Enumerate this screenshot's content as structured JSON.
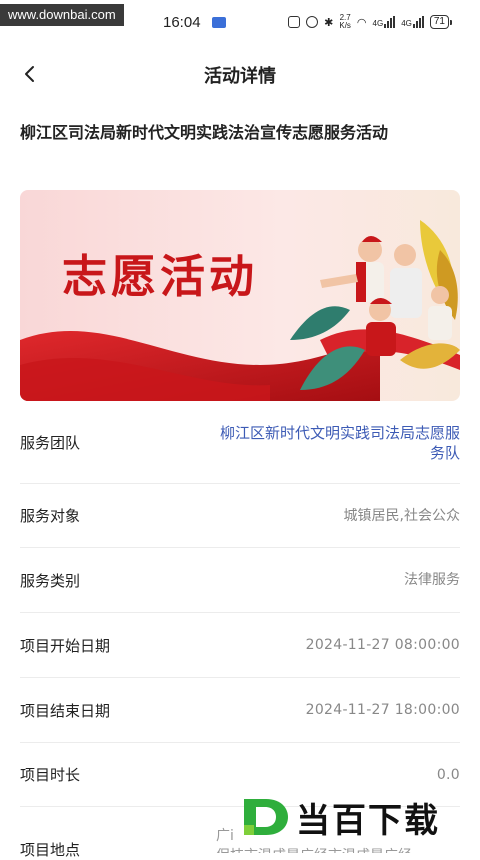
{
  "watermark_top": "www.downbai.com",
  "status": {
    "time": "16:04",
    "net_speed_top": "2.7",
    "net_speed_bottom": "K/s",
    "battery": "71",
    "net1": "4G",
    "net2": "4G"
  },
  "header": {
    "title": "活动详情"
  },
  "activity": {
    "title": "柳江区司法局新时代文明实践法治宣传志愿服务活动",
    "banner_text": "志愿活动"
  },
  "details": [
    {
      "label": "服务团队",
      "value": "柳江区新时代文明实践司法局志愿服务队"
    },
    {
      "label": "服务对象",
      "value": "城镇居民,社会公众"
    },
    {
      "label": "服务类别",
      "value": "法律服务"
    },
    {
      "label": "项目开始日期",
      "value": "2024-11-27 08:00:00"
    },
    {
      "label": "项目结束日期",
      "value": "2024-11-27 18:00:00"
    },
    {
      "label": "项目时长",
      "value": "0.0"
    },
    {
      "label": "项目地点",
      "value": "广i\n保技市温成是广经市温成是广经"
    }
  ],
  "watermark_bottom": "当百下载",
  "colors": {
    "link": "#3d5bb5",
    "banner_red": "#c8171a"
  }
}
